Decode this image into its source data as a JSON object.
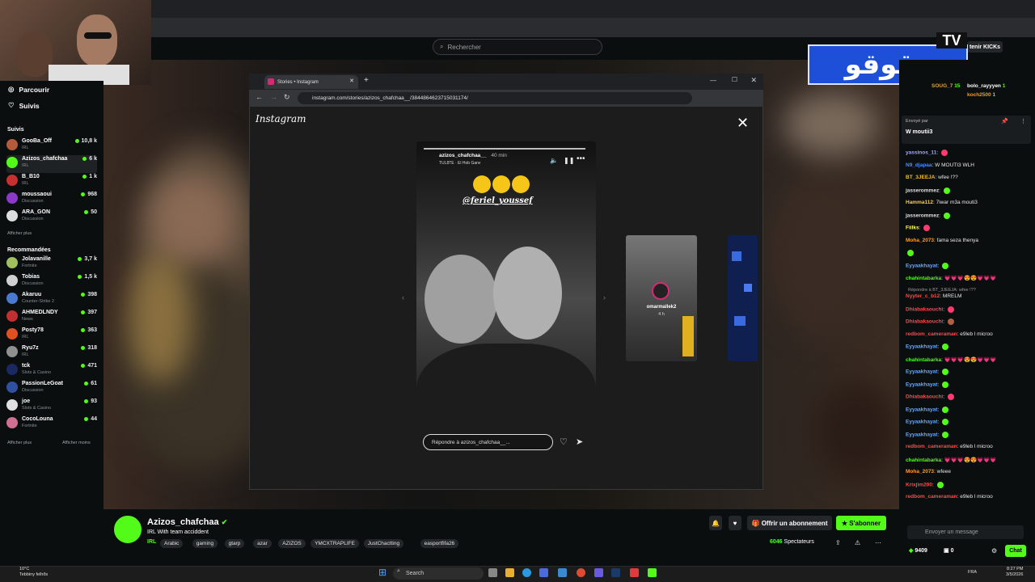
{
  "kick": {
    "search_placeholder": "Rechercher",
    "follow_label": "tenir KICKs"
  },
  "logo": {
    "text": "زقوقو",
    "tv": "TV"
  },
  "sidebar": {
    "nav": [
      {
        "label": "Parcourir",
        "icon": "compass-icon"
      },
      {
        "label": "Suivis",
        "icon": "heart-icon"
      }
    ],
    "followed_title": "Suivis",
    "followed": [
      {
        "name": "GooBa_Off",
        "category": "IRL",
        "viewers": "10,8 k",
        "color": "#b35b3a"
      },
      {
        "name": "Azizos_chafchaa",
        "category": "IRL",
        "viewers": "6 k",
        "color": "#53fc18"
      },
      {
        "name": "B_B10",
        "category": "IRL",
        "viewers": "1 k",
        "color": "#c73030"
      },
      {
        "name": "moussaoui",
        "category": "Discussion",
        "viewers": "968",
        "color": "#8a3ac7"
      },
      {
        "name": "ARA_GON",
        "category": "Discussion",
        "viewers": "50",
        "color": "#dddddd"
      }
    ],
    "followed_more": "Afficher plus",
    "recommended_title": "Recommandées",
    "recommended": [
      {
        "name": "Jolavanille",
        "category": "Fortnite",
        "viewers": "3,7 k",
        "color": "#a0c060"
      },
      {
        "name": "Tobias",
        "category": "Discussion",
        "viewers": "1,5 k",
        "color": "#d0d0d0"
      },
      {
        "name": "Akaruu",
        "category": "Counter-Strike 2",
        "viewers": "398",
        "color": "#4a7ad0"
      },
      {
        "name": "AHMEDLNDY",
        "category": "News",
        "viewers": "397",
        "color": "#c03030"
      },
      {
        "name": "Posty78",
        "category": "IRL",
        "viewers": "363",
        "color": "#e05020"
      },
      {
        "name": "Ryu7z",
        "category": "IRL",
        "viewers": "318",
        "color": "#909090"
      },
      {
        "name": "tck",
        "category": "Slots & Casino",
        "viewers": "471",
        "color": "#1a2a60"
      },
      {
        "name": "PassionLeGoat",
        "category": "Discussion",
        "viewers": "61",
        "color": "#3050a0"
      },
      {
        "name": "joe",
        "category": "Slots & Casino",
        "viewers": "93",
        "color": "#e0e0e0"
      },
      {
        "name": "CocoLouna",
        "category": "Fortnite",
        "viewers": "44",
        "color": "#d07090"
      }
    ],
    "show_more": "Afficher plus",
    "show_less": "Afficher moins"
  },
  "inner_browser": {
    "tab_title": "Stories • Instagram",
    "url": "instagram.com/stories/azizos_chafchaa__/3844864623715031174/"
  },
  "instagram": {
    "logo": "Instagram",
    "story_user": "azizos_chafchaa__",
    "story_time": "40 min",
    "story_music": "TUL8TE · El Hob Ganv",
    "mention": "@feriel_youssef",
    "reply_placeholder": "Répondre à azizos_chafchaa__...",
    "next_story_user": "omarmallek2",
    "next_story_time": "4 h"
  },
  "chat": {
    "leaderboard": [
      {
        "name": "SOUG_7",
        "value": "15"
      },
      {
        "name": "bolo_rayyyen",
        "value": "1"
      },
      {
        "name": "koch2500",
        "value": "1"
      }
    ],
    "pinned_label": "Envoyé par",
    "pinned_message": "W moutii3",
    "messages": [
      {
        "user": "yassinos_11",
        "text": "",
        "color": "#a0a8ff",
        "emote": "#ff3a70"
      },
      {
        "user": "N9_djapaa",
        "text": "W MOUTI3 WLH",
        "color": "#4a90ff",
        "emote": ""
      },
      {
        "user": "BT_3JEEJA",
        "text": "wfee !??",
        "color": "#f0c020",
        "emote": ""
      },
      {
        "user": "jasserommez",
        "text": "",
        "color": "#e0e0e0",
        "emote": "#53fc18"
      },
      {
        "user": "Hamma112",
        "text": "7iwar m3a mouti3",
        "color": "#ffcc44",
        "emote": ""
      },
      {
        "user": "jasserommez",
        "text": "",
        "color": "#e0e0e0",
        "emote": "#53fc18"
      },
      {
        "user": "Fiilks",
        "text": "",
        "color": "#ffff66",
        "emote": "#ff3a70"
      },
      {
        "user": "Moha_2073",
        "text": "fama seza thenya",
        "color": "#ff9a30",
        "emote": ""
      },
      {
        "user": "",
        "text": "",
        "color": "#e0e0e0",
        "emote": "#53fc18"
      },
      {
        "user": "Eyyaakhayat",
        "text": "",
        "color": "#66aaff",
        "emote": "#53fc18"
      },
      {
        "user": "chahintabarka",
        "text": "💗💗💗😍😍💗💗💗",
        "color": "#53fc18",
        "emote": ""
      },
      {
        "user": "Nyyter_c_b12",
        "text": "MRELM",
        "color": "#ff4a4a",
        "emote": ""
      },
      {
        "user": "Dhiabakaouchi",
        "text": "",
        "color": "#ff4a4a",
        "emote": "#ff3a70"
      },
      {
        "user": "Dhiabakaouchi",
        "text": "",
        "color": "#ff4a4a",
        "emote": "#b06040"
      },
      {
        "user": "redbom_cameraman",
        "text": "e9leb l microo",
        "color": "#ff4a4a",
        "emote": ""
      },
      {
        "user": "Eyyaakhayat",
        "text": "",
        "color": "#66aaff",
        "emote": "#53fc18"
      },
      {
        "user": "chahintabarka",
        "text": "💗💗💗😍😍💗💗💗",
        "color": "#53fc18",
        "emote": ""
      },
      {
        "user": "Eyyaakhayat",
        "text": "",
        "color": "#66aaff",
        "emote": "#53fc18"
      },
      {
        "user": "Eyyaakhayat",
        "text": "",
        "color": "#66aaff",
        "emote": "#53fc18"
      },
      {
        "user": "Dhiabakaouchi",
        "text": "",
        "color": "#ff4a4a",
        "emote": "#ff3a70"
      },
      {
        "user": "Eyyaakhayat",
        "text": "",
        "color": "#66aaff",
        "emote": "#53fc18"
      },
      {
        "user": "Eyyaakhayat",
        "text": "",
        "color": "#66aaff",
        "emote": "#53fc18"
      },
      {
        "user": "Eyyaakhayat",
        "text": "",
        "color": "#66aaff",
        "emote": "#53fc18"
      },
      {
        "user": "redbom_cameraman",
        "text": "e9leb l microo",
        "color": "#ff4a4a",
        "emote": ""
      },
      {
        "user": "chahintabarka",
        "text": "💗💗💗😍😍💗💗💗",
        "color": "#53fc18",
        "emote": ""
      },
      {
        "user": "Moha_2073",
        "text": "wfeee",
        "color": "#ff9a30",
        "emote": ""
      },
      {
        "user": "Krixjim200",
        "text": "",
        "color": "#ff4a4a",
        "emote": "#53fc18"
      },
      {
        "user": "redbom_cameraman",
        "text": "e9leb l microo",
        "color": "#ff4a4a",
        "emote": ""
      }
    ],
    "reply_to": "Répondre à BT_3JEEJA: wfee !??",
    "input_placeholder": "Envoyer un message",
    "points": "9409",
    "count": "0",
    "chat_button": "Chat"
  },
  "stream": {
    "streamer": "Azizos_chafchaa",
    "title": "IRL With team acciddent",
    "category": "IRL",
    "tags": [
      "Arabic",
      "gaming",
      "gtarp",
      "azar",
      "AZIZOS",
      "YMCXTRAPLIFE",
      "JustChactting",
      "easportfifa26"
    ],
    "subscribe_label": "Offrir un abonnement",
    "follow_label": "S'abonner",
    "viewers": "6046",
    "viewers_label": "Spectateurs"
  },
  "taskbar": {
    "weather_temp": "10°C",
    "weather_desc": "Tebbiny felhős",
    "search": "Search",
    "lang": "FRA",
    "time": "8:27 PM",
    "date": "3/5/2026"
  }
}
